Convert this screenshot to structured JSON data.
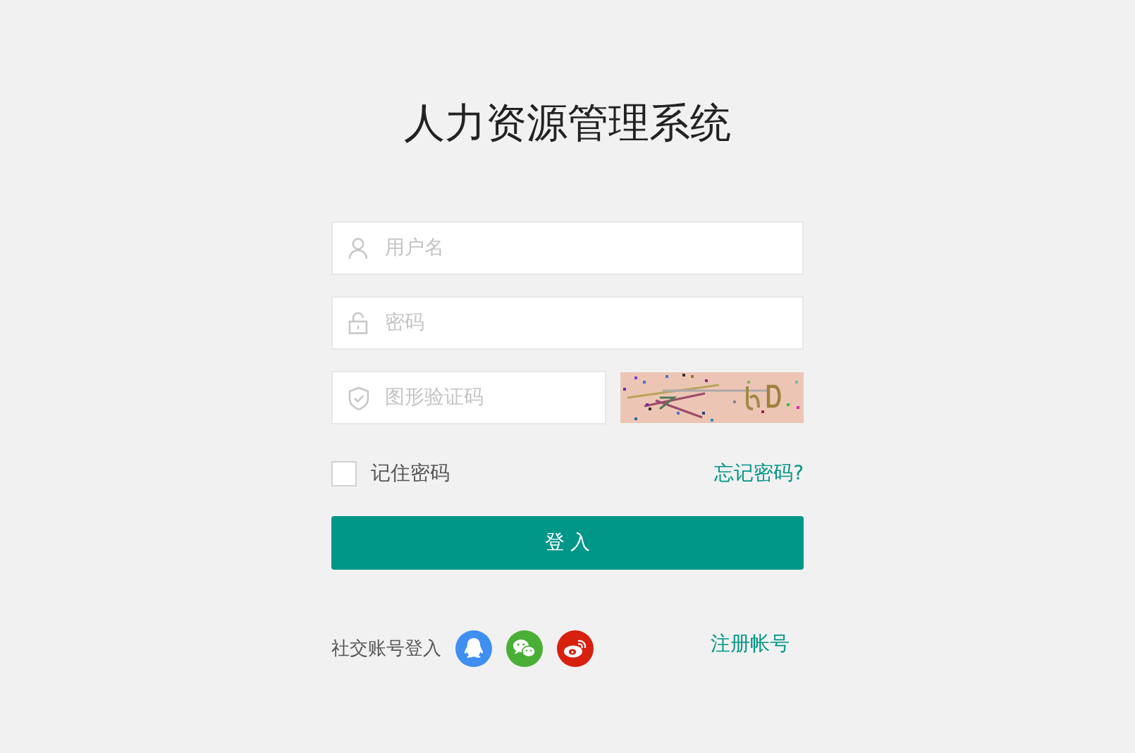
{
  "title": "人力资源管理系统",
  "fields": [
    {
      "kind": "user",
      "placeholder": "用户名"
    },
    {
      "kind": "password",
      "placeholder": "密码"
    },
    {
      "kind": "captcha",
      "placeholder": "图形验证码"
    }
  ],
  "remember": {
    "label": "记住密码",
    "checked": false
  },
  "forgot_link": "忘记密码?",
  "login_button": "登 入",
  "social": {
    "label": "社交账号登入",
    "providers": [
      {
        "kind": "qq"
      },
      {
        "kind": "wechat"
      },
      {
        "kind": "weibo"
      }
    ]
  },
  "register_link": "注册帐号"
}
